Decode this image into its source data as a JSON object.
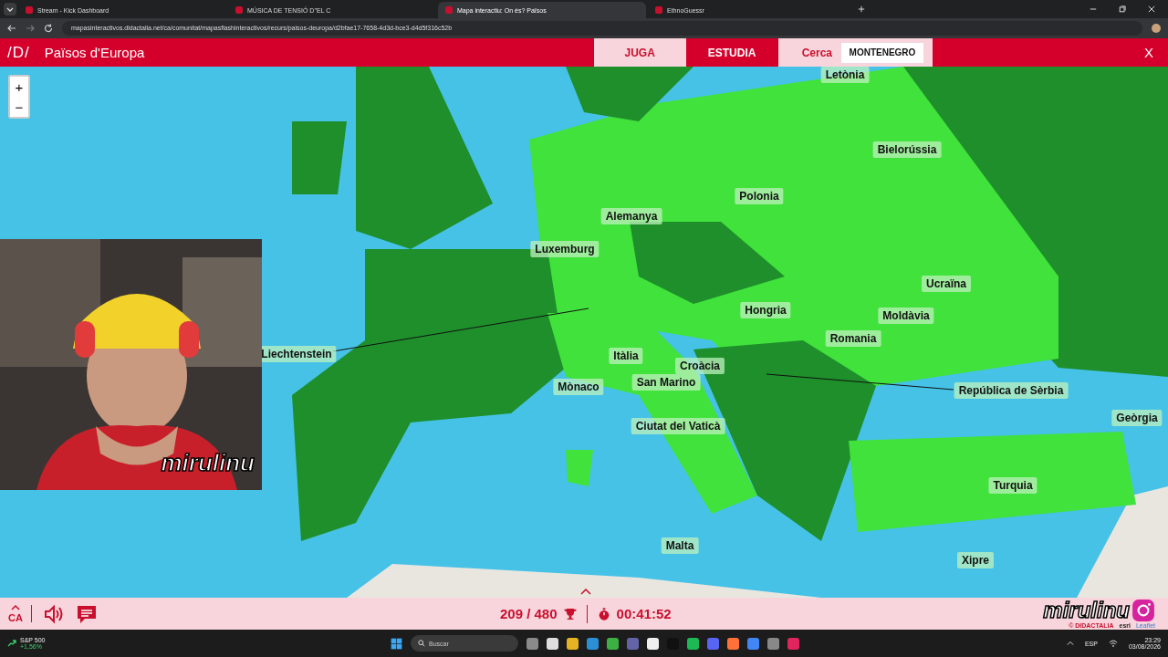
{
  "browser": {
    "tabs": [
      {
        "title": "Stream - Kick Dashboard",
        "selected": false
      },
      {
        "title": "MÚSICA DE TENSIÓ D''EL C",
        "selected": false
      },
      {
        "title": "Mapa interactiu: On és? Països",
        "selected": true
      },
      {
        "title": "EthnoGuessr",
        "selected": false
      }
    ],
    "url": "mapasinteractivos.didactalia.net/ca/comunitat/mapasflashinteractivos/recurs/paisos-deuropa/d2bfae17-7658-4d3d-bce3-d4d5f316c52b"
  },
  "header": {
    "logo": "/D/",
    "title": "Països d'Europa",
    "modes": [
      {
        "label": "JUGA",
        "selected": true
      },
      {
        "label": "ESTUDIA",
        "selected": false
      }
    ],
    "search_label": "Cerca",
    "search_value": "MONTENEGRO",
    "close": "X"
  },
  "map": {
    "zoom_in": "+",
    "zoom_out": "−",
    "labels": [
      "Letònia",
      "Bielorússia",
      "Polonia",
      "Alemanya",
      "Luxemburg",
      "Ucraïna",
      "Hongria",
      "Moldàvia",
      "Romania",
      "Liechtenstein",
      "Itàlia",
      "Croàcia",
      "San Marino",
      "Mònaco",
      "República de Sèrbia",
      "Geòrgia",
      "Ciutat del Vaticà",
      "Turquia",
      "Malta",
      "Xipre"
    ],
    "webcam": {
      "streamer_tag": "mirulinu"
    }
  },
  "footer": {
    "language": "CA",
    "score": "209 / 480",
    "time": "00:41:52",
    "streamer_tag": "mirulinu",
    "attribution": [
      "© DIDACTALIA",
      "esri",
      "Leaflet"
    ]
  },
  "taskbar": {
    "stock_name": "S&P 500",
    "stock_change": "+1,56%",
    "search_placeholder": "Buscar",
    "language": "ESP",
    "time": "23:29",
    "date": "03/08/2026"
  }
}
